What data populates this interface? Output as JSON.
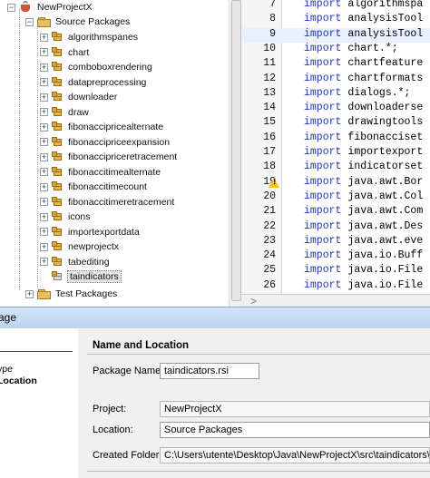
{
  "tree": {
    "project": "NewProjectX",
    "source_packages": "Source Packages",
    "packages": [
      "algorithmspanes",
      "chart",
      "comboboxrendering",
      "datapreprocessing",
      "downloader",
      "draw",
      "fibonaccipricealternate",
      "fibonaccipriceexpansion",
      "fibonaccipriceretracement",
      "fibonaccitimealternate",
      "fibonaccitimecount",
      "fibonaccitimeretracement",
      "icons",
      "importexportdata",
      "newprojectx",
      "tabediting",
      "taindicators"
    ],
    "test_packages": "Test Packages"
  },
  "editor": {
    "lines": [
      {
        "n": "7",
        "kw": "import",
        "text": "algorithmspa"
      },
      {
        "n": "8",
        "kw": "import",
        "text": "analysisTool"
      },
      {
        "n": "9",
        "kw": "import",
        "text": "analysisTool"
      },
      {
        "n": "10",
        "kw": "import",
        "text": "chart.*;"
      },
      {
        "n": "11",
        "kw": "import",
        "text": "chartfeature"
      },
      {
        "n": "12",
        "kw": "import",
        "text": "chartformats"
      },
      {
        "n": "13",
        "kw": "import",
        "text": "dialogs.*;"
      },
      {
        "n": "14",
        "kw": "import",
        "text": "downloaderse"
      },
      {
        "n": "15",
        "kw": "import",
        "text": "drawingtools"
      },
      {
        "n": "16",
        "kw": "import",
        "text": "fibonacciset"
      },
      {
        "n": "17",
        "kw": "import",
        "text": "importexport"
      },
      {
        "n": "18",
        "kw": "import",
        "text": "indicatorset"
      },
      {
        "n": "19",
        "kw": "import",
        "text": "java.awt.Bor"
      },
      {
        "n": "20",
        "kw": "import",
        "text": "java.awt.Col"
      },
      {
        "n": "21",
        "kw": "import",
        "text": "java.awt.Com"
      },
      {
        "n": "22",
        "kw": "import",
        "text": "java.awt.Des"
      },
      {
        "n": "23",
        "kw": "import",
        "text": "java.awt.eve"
      },
      {
        "n": "24",
        "kw": "import",
        "text": "java.io.Buff"
      },
      {
        "n": "25",
        "kw": "import",
        "text": "java.io.File"
      },
      {
        "n": "26",
        "kw": "import",
        "text": "java.io.File"
      }
    ]
  },
  "dialog": {
    "title": "age",
    "steps": [
      "ype",
      "Location"
    ],
    "section_title": "Name and Location",
    "package_name_label": "Package Name:",
    "package_name_value": "taindicators.rsi",
    "project_label": "Project:",
    "project_value": "NewProjectX",
    "location_label": "Location:",
    "location_value": "Source Packages",
    "created_folder_label": "Created Folder:",
    "created_folder_value": "C:\\Users\\utente\\Desktop\\Java\\NewProjectX\\src\\taindicators\\rsi"
  }
}
